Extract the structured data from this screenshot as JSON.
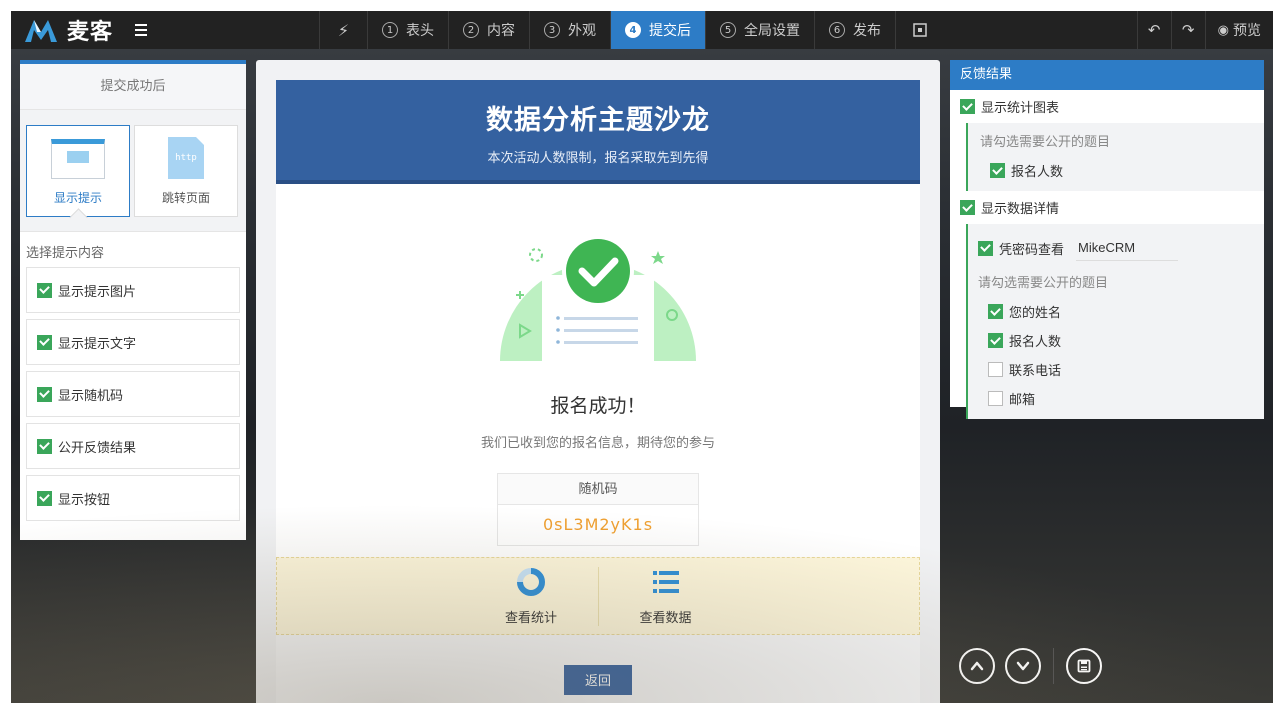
{
  "brand": {
    "name": "麦客"
  },
  "colors": {
    "accent": "#2d7cc6",
    "header": "#3461a0",
    "check": "#3aa65a",
    "code": "#f0a030"
  },
  "nav": {
    "steps": [
      {
        "num": "1",
        "label": "表头"
      },
      {
        "num": "2",
        "label": "内容"
      },
      {
        "num": "3",
        "label": "外观"
      },
      {
        "num": "4",
        "label": "提交后"
      },
      {
        "num": "5",
        "label": "全局设置"
      },
      {
        "num": "6",
        "label": "发布"
      }
    ],
    "active_step": "4",
    "preview_label": "预览"
  },
  "left": {
    "title": "提交成功后",
    "choices": [
      {
        "label": "显示提示",
        "icon": "browser-window-icon",
        "active": true
      },
      {
        "label": "跳转页面",
        "icon": "http-file-icon",
        "active": false,
        "icon_text": "http"
      }
    ],
    "section_label": "选择提示内容",
    "options": [
      {
        "label": "显示提示图片",
        "checked": true
      },
      {
        "label": "显示提示文字",
        "checked": true
      },
      {
        "label": "显示随机码",
        "checked": true
      },
      {
        "label": "公开反馈结果",
        "checked": true
      },
      {
        "label": "显示按钮",
        "checked": true
      }
    ]
  },
  "card": {
    "title": "数据分析主题沙龙",
    "subtitle": "本次活动人数限制，报名采取先到先得",
    "success_title": "报名成功！",
    "success_desc": "我们已收到您的报名信息，期待您的参与",
    "code_label": "随机码",
    "code_value": "0sL3M2yK1s",
    "actions": [
      {
        "label": "查看统计",
        "icon": "donut-chart-icon"
      },
      {
        "label": "查看数据",
        "icon": "list-icon"
      }
    ],
    "back_button": "返回"
  },
  "right": {
    "title": "反馈结果",
    "show_chart": {
      "label": "显示统计图表",
      "checked": true
    },
    "chart_hint": "请勾选需要公开的题目",
    "chart_items": [
      {
        "label": "报名人数",
        "checked": true
      }
    ],
    "show_detail": {
      "label": "显示数据详情",
      "checked": true
    },
    "password": {
      "label": "凭密码查看",
      "checked": true,
      "value": "MikeCRM"
    },
    "detail_hint": "请勾选需要公开的题目",
    "detail_items": [
      {
        "label": "您的姓名",
        "checked": true
      },
      {
        "label": "报名人数",
        "checked": true
      },
      {
        "label": "联系电话",
        "checked": false
      },
      {
        "label": "邮箱",
        "checked": false
      }
    ]
  }
}
